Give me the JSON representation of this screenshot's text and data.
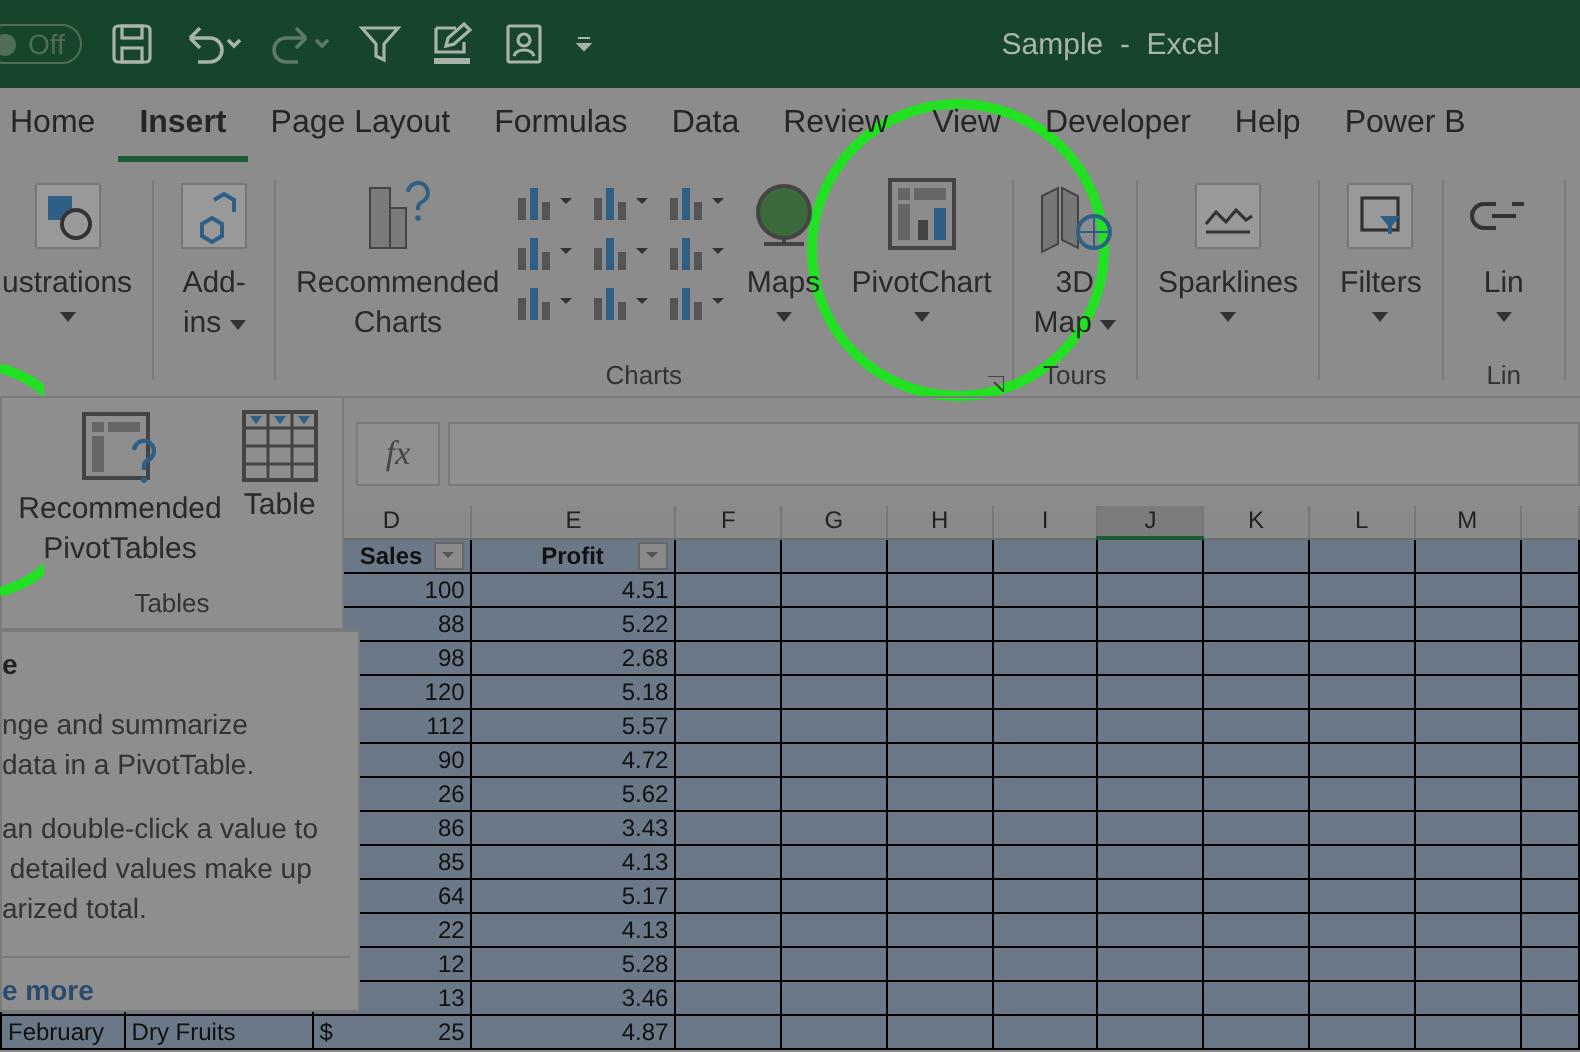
{
  "title_bar": {
    "toggle": {
      "label": "Off",
      "on": false
    },
    "title": "Sample  -  Excel"
  },
  "tabs": [
    {
      "label": "Home",
      "selected": false
    },
    {
      "label": "Insert",
      "selected": true
    },
    {
      "label": "Page Layout",
      "selected": false
    },
    {
      "label": "Formulas",
      "selected": false
    },
    {
      "label": "Data",
      "selected": false
    },
    {
      "label": "Review",
      "selected": false
    },
    {
      "label": "View",
      "selected": false
    },
    {
      "label": "Developer",
      "selected": false
    },
    {
      "label": "Help",
      "selected": false
    },
    {
      "label": "Power B",
      "selected": false
    }
  ],
  "ribbon": {
    "groups": [
      {
        "buttons": [
          {
            "kind": "dropdown",
            "label": "ustrations"
          }
        ]
      },
      {
        "buttons": [
          {
            "kind": "split",
            "label": "Add-\nins"
          }
        ]
      },
      {
        "label": "Charts",
        "buttons": [
          {
            "kind": "plain",
            "label": "Recommended\nCharts"
          },
          {
            "kind": "gallery"
          },
          {
            "kind": "dropdown",
            "label": "Maps"
          },
          {
            "kind": "dropdown",
            "label": "PivotChart"
          }
        ]
      },
      {
        "label": "Tours",
        "buttons": [
          {
            "kind": "split",
            "label": "3D\nMap"
          }
        ]
      },
      {
        "buttons": [
          {
            "kind": "dropdown",
            "label": "Sparklines"
          }
        ]
      },
      {
        "buttons": [
          {
            "kind": "dropdown",
            "label": "Filters"
          }
        ]
      },
      {
        "label": "Lin",
        "buttons": [
          {
            "kind": "dropdown",
            "label": "Lin"
          }
        ]
      }
    ]
  },
  "tables_menu": {
    "buttons": [
      {
        "label": "Recommended\nPivotTables"
      },
      {
        "label": "Table"
      }
    ],
    "label": "Tables"
  },
  "formula_bar": {
    "function_button": "fx"
  },
  "tooltip": {
    "title": "e",
    "paragraphs": [
      [
        "nge and summarize",
        "data in a PivotTable."
      ],
      [
        "an double-click a value to",
        " detailed values make up",
        "arized total."
      ]
    ],
    "link": "e more"
  },
  "columns": [
    {
      "letter": "D",
      "selected": false
    },
    {
      "letter": "E",
      "selected": false
    },
    {
      "letter": "F",
      "selected": false
    },
    {
      "letter": "G",
      "selected": false
    },
    {
      "letter": "H",
      "selected": false
    },
    {
      "letter": "I",
      "selected": false
    },
    {
      "letter": "J",
      "selected": true
    },
    {
      "letter": "K",
      "selected": false
    },
    {
      "letter": "L",
      "selected": false
    },
    {
      "letter": "M",
      "selected": false
    }
  ],
  "header_row": {
    "sales": "Sales",
    "profit": "Profit"
  },
  "rows": [
    {
      "sales": "100",
      "profit": "4.51"
    },
    {
      "sales": "88",
      "profit": "5.22"
    },
    {
      "sales": "98",
      "profit": "2.68"
    },
    {
      "sales": "120",
      "profit": "5.18"
    },
    {
      "sales": "112",
      "profit": "5.57"
    },
    {
      "sales": "90",
      "profit": "4.72"
    },
    {
      "sales": "26",
      "profit": "5.62"
    },
    {
      "sales": "86",
      "profit": "3.43"
    },
    {
      "sales": "85",
      "profit": "4.13"
    },
    {
      "sales": "64",
      "profit": "5.17"
    },
    {
      "sales": "22",
      "profit": "4.13"
    },
    {
      "sales": "12",
      "profit": "5.28"
    },
    {
      "sales": "13",
      "profit": "3.46"
    },
    {
      "month": "February",
      "product": "Dry Fruits",
      "currency": "$",
      "sales": "25",
      "profit": "4.87"
    }
  ]
}
